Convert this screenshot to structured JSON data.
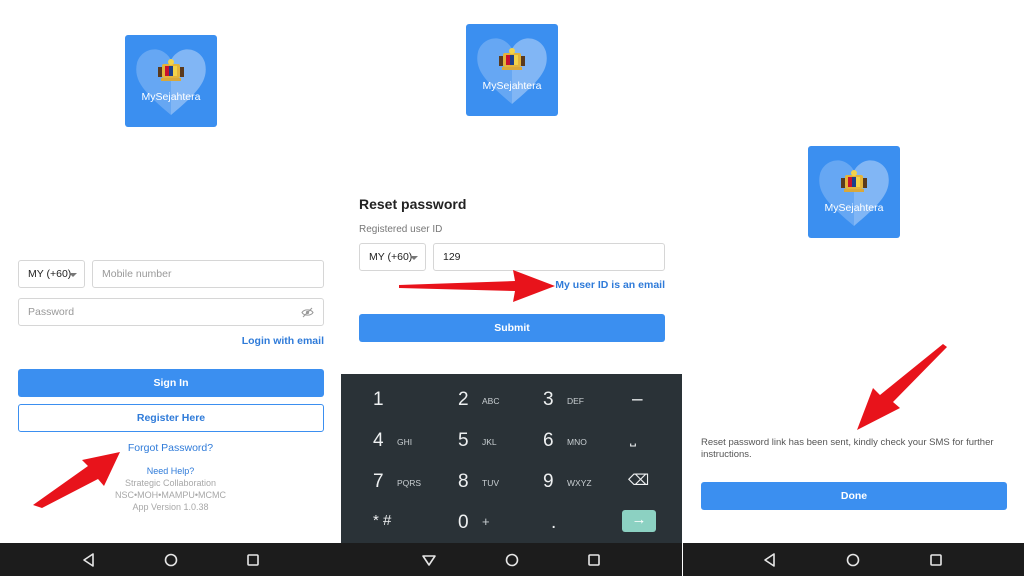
{
  "app": {
    "logo_text": "MySejahtera"
  },
  "colors": {
    "accent": "#3b8ff0",
    "link": "#2f7bd9",
    "arrow": "#e8131b",
    "keyboard_bg": "#2a3237",
    "enter_key": "#8cd1c2",
    "navbar": "#1c1c1c"
  },
  "login": {
    "country_code": "MY (+60)",
    "mobile_placeholder": "Mobile number",
    "password_placeholder": "Password",
    "password_toggle_icon": "eye-off-icon",
    "login_email_link": "Login with email",
    "sign_in_label": "Sign In",
    "register_label": "Register Here",
    "forgot_password_link": "Forgot Password?",
    "help_link": "Need Help?",
    "collab_label": "Strategic Collaboration",
    "collab_orgs": "NSC•MOH•MAMPU•MCMC",
    "app_version": "App Version 1.0.38"
  },
  "reset": {
    "title": "Reset password",
    "field_label": "Registered user ID",
    "country_code": "MY (+60)",
    "user_id_value": "129",
    "email_link": "My user ID is an email",
    "submit_label": "Submit"
  },
  "keyboard": {
    "rows": [
      [
        {
          "n": "1",
          "s": ""
        },
        {
          "n": "2",
          "s": "ABC"
        },
        {
          "n": "3",
          "s": "DEF"
        },
        {
          "n": "–",
          "s": ""
        }
      ],
      [
        {
          "n": "4",
          "s": "GHI"
        },
        {
          "n": "5",
          "s": "JKL"
        },
        {
          "n": "6",
          "s": "MNO"
        },
        {
          "n": "⎵",
          "s": ""
        }
      ],
      [
        {
          "n": "7",
          "s": "PQRS"
        },
        {
          "n": "8",
          "s": "TUV"
        },
        {
          "n": "9",
          "s": "WXYZ"
        },
        {
          "n": "⌫",
          "s": ""
        }
      ],
      [
        {
          "n": "* #",
          "s": ""
        },
        {
          "n": "0",
          "s": "+"
        },
        {
          "n": ".",
          "s": ""
        },
        {
          "n": "→",
          "s": ""
        }
      ]
    ]
  },
  "confirm": {
    "message": "Reset password link has been sent, kindly check your SMS for further instructions.",
    "done_label": "Done"
  },
  "navbar": {
    "icons": [
      "back-icon",
      "home-icon",
      "recents-icon"
    ]
  }
}
